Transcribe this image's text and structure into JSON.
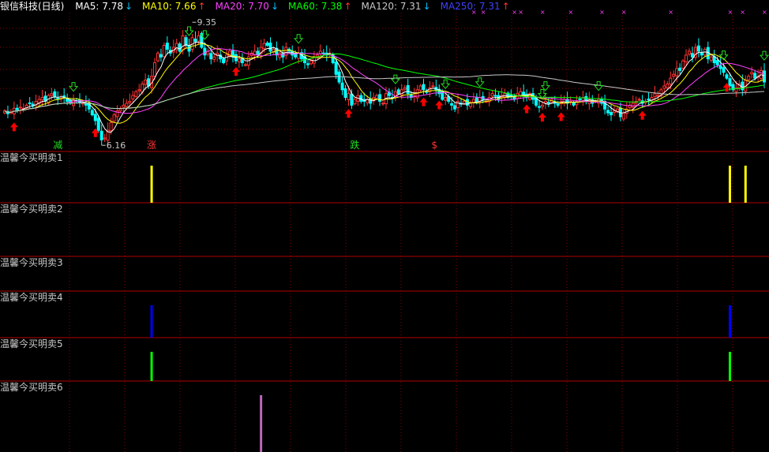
{
  "header": {
    "title": "银信科技(日线)",
    "ma_items": [
      {
        "label": "MA5: 7.78",
        "arrow": "↓",
        "color": "#ffffff",
        "arrow_color": "#00c0ff"
      },
      {
        "label": "MA10: 7.66",
        "arrow": "↑",
        "color": "#ffff00",
        "arrow_color": "#ff3030"
      },
      {
        "label": "MA20: 7.70",
        "arrow": "↓",
        "color": "#ff40ff",
        "arrow_color": "#00c0ff"
      },
      {
        "label": "MA60: 7.38",
        "arrow": "↑",
        "color": "#00ff00",
        "arrow_color": "#ff3030"
      },
      {
        "label": "MA120: 7.31",
        "arrow": "↓",
        "color": "#c8c8c8",
        "arrow_color": "#00c0ff"
      },
      {
        "label": "MA250: 7.31",
        "arrow": "↑",
        "color": "#4040ff",
        "arrow_color": "#ff3030"
      }
    ]
  },
  "colors": {
    "up": "#ff3333",
    "down": "#00ffff",
    "grid": "#8b0000",
    "buy": "#ff0000",
    "sell": "#22dd22"
  },
  "chart_data": {
    "type": "candlestick",
    "price_range": [
      6.0,
      9.6
    ],
    "annotations": [
      {
        "text": "9.35",
        "x_index": 60,
        "price": 9.35
      },
      {
        "text": "6.16",
        "x_index": 31,
        "price": 6.16
      }
    ],
    "signal_labels": [
      {
        "text": "减",
        "x_index": 17,
        "color": "#22dd22"
      },
      {
        "text": "涨",
        "x_index": 47,
        "color": "#ff3333"
      },
      {
        "text": "跌",
        "x_index": 112,
        "color": "#22dd22"
      },
      {
        "text": "$",
        "x_index": 138,
        "color": "#ff3333"
      }
    ],
    "closes": [
      7.05,
      6.98,
      7.02,
      7.12,
      7.08,
      7.15,
      7.12,
      7.2,
      7.25,
      7.18,
      7.3,
      7.35,
      7.4,
      7.3,
      7.45,
      7.5,
      7.42,
      7.35,
      7.38,
      7.4,
      7.3,
      7.25,
      7.33,
      7.3,
      7.28,
      7.25,
      7.2,
      7.1,
      6.95,
      6.8,
      6.55,
      6.3,
      6.35,
      6.55,
      6.75,
      6.95,
      7.05,
      7.1,
      7.2,
      7.25,
      7.3,
      7.45,
      7.55,
      7.6,
      7.75,
      7.85,
      7.7,
      7.95,
      8.3,
      8.55,
      8.45,
      8.75,
      8.65,
      8.55,
      8.7,
      8.8,
      8.6,
      9.0,
      8.75,
      8.6,
      8.95,
      8.85,
      9.0,
      8.7,
      8.5,
      8.6,
      8.4,
      8.45,
      8.55,
      8.4,
      8.3,
      8.5,
      8.6,
      8.45,
      8.35,
      8.4,
      8.3,
      8.25,
      8.45,
      8.55,
      8.6,
      8.5,
      8.7,
      8.8,
      8.75,
      8.6,
      8.65,
      8.5,
      8.55,
      8.45,
      8.7,
      8.6,
      8.5,
      8.45,
      8.55,
      8.4,
      8.3,
      8.25,
      8.35,
      8.45,
      8.5,
      8.6,
      8.55,
      8.5,
      8.55,
      8.3,
      8.0,
      7.8,
      7.6,
      7.4,
      7.5,
      7.2,
      7.35,
      7.45,
      7.3,
      7.3,
      7.35,
      7.25,
      7.4,
      7.45,
      7.3,
      7.25,
      7.5,
      7.45,
      7.4,
      7.55,
      7.5,
      7.6,
      7.65,
      7.5,
      7.4,
      7.45,
      7.6,
      7.7,
      7.6,
      7.55,
      7.65,
      7.7,
      7.6,
      7.5,
      7.35,
      7.4,
      7.3,
      7.2,
      7.1,
      7.3,
      7.25,
      7.3,
      7.2,
      7.25,
      7.35,
      7.3,
      7.4,
      7.35,
      7.3,
      7.4,
      7.5,
      7.45,
      7.35,
      7.45,
      7.5,
      7.4,
      7.45,
      7.35,
      7.5,
      7.55,
      7.45,
      7.4,
      7.5,
      7.35,
      7.2,
      7.15,
      7.2,
      7.3,
      7.25,
      7.35,
      7.25,
      7.2,
      7.3,
      7.35,
      7.25,
      7.3,
      7.2,
      7.3,
      7.35,
      7.4,
      7.3,
      7.35,
      7.25,
      7.3,
      7.35,
      7.25,
      7.1,
      7.0,
      6.95,
      7.05,
      7.1,
      6.9,
      7.0,
      7.1,
      7.2,
      7.25,
      7.3,
      7.35,
      7.25,
      7.3,
      7.35,
      7.4,
      7.5,
      7.45,
      7.6,
      7.7,
      7.75,
      7.9,
      8.0,
      8.15,
      8.1,
      8.35,
      8.5,
      8.6,
      8.45,
      8.7,
      8.6,
      8.5,
      8.65,
      8.4,
      8.45,
      8.3,
      8.25,
      8.15,
      8.05,
      7.9,
      7.7,
      7.6,
      7.65,
      7.75,
      7.6,
      7.85,
      7.95,
      8.05,
      7.9,
      7.95,
      8.1,
      7.8
    ]
  },
  "panels": [
    {
      "label": "温馨今买明卖1",
      "bars": [
        {
          "x_index": 47,
          "color": "#ffff00"
        },
        {
          "x_index": 232,
          "color": "#ffff00"
        },
        {
          "x_index": 237,
          "color": "#ffff00"
        }
      ]
    },
    {
      "label": "温馨今买明卖2",
      "bars": []
    },
    {
      "label": "温馨今买明卖3",
      "bars": []
    },
    {
      "label": "温馨今买明卖4",
      "bars": [
        {
          "x_index": 47,
          "color": "#0000ff"
        },
        {
          "x_index": 232,
          "color": "#0000ff"
        }
      ]
    },
    {
      "label": "温馨今买明卖5",
      "bars": [
        {
          "x_index": 47,
          "color": "#00ff00"
        },
        {
          "x_index": 232,
          "color": "#00ff00"
        }
      ]
    },
    {
      "label": "温馨今买明卖6",
      "bars": [
        {
          "x_index": 82,
          "color": "#bb66bb"
        }
      ]
    }
  ]
}
